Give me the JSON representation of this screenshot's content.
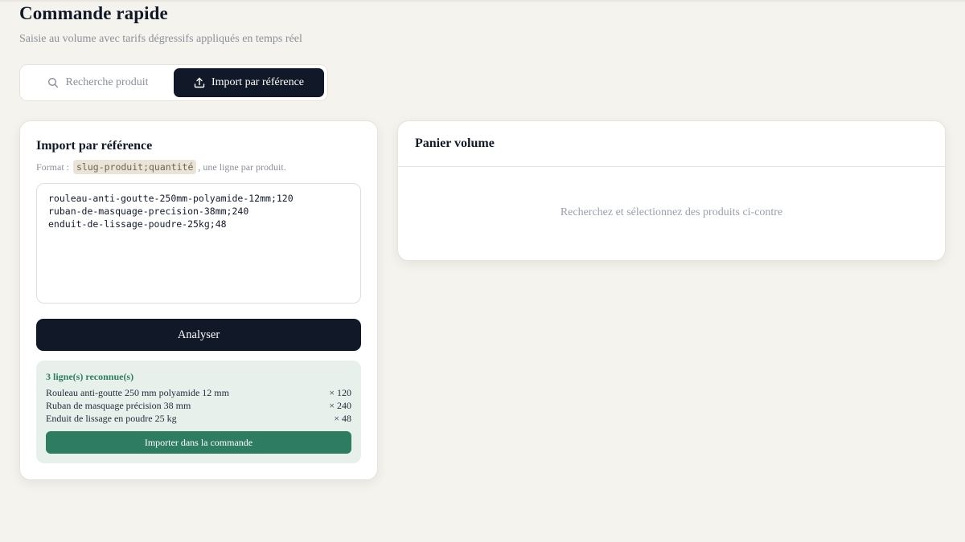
{
  "header": {
    "title": "Commande rapide",
    "subtitle": "Saisie au volume avec tarifs dégressifs appliqués en temps réel"
  },
  "mode_tabs": {
    "search": {
      "label": "Recherche produit",
      "icon": "search-icon",
      "active": false
    },
    "import": {
      "label": "Import par référence",
      "icon": "upload-icon",
      "active": true
    }
  },
  "import_panel": {
    "title": "Import par référence",
    "format_prefix": "Format :",
    "format_code": "slug-produit;quantité",
    "format_suffix": ", une ligne par produit.",
    "textarea_value": "rouleau-anti-goutte-250mm-polyamide-12mm;120\nruban-de-masquage-precision-38mm;240\nenduit-de-lissage-poudre-25kg;48",
    "analyze_label": "Analyser",
    "result": {
      "title": "3 ligne(s) reconnue(s)",
      "items": [
        {
          "name": "Rouleau anti-goutte 250 mm polyamide 12 mm",
          "qty": "× 120"
        },
        {
          "name": "Ruban de masquage précision 38 mm",
          "qty": "× 240"
        },
        {
          "name": "Enduit de lissage en poudre 25 kg",
          "qty": "× 48"
        }
      ],
      "import_label": "Importer dans la commande"
    }
  },
  "cart_panel": {
    "title": "Panier volume",
    "empty_text": "Recherchez et sélectionnez des produits ci-contre"
  },
  "colors": {
    "background": "#f5f3ee",
    "primary_dark": "#111827",
    "success_green": "#2e7d62",
    "success_bg": "#e8f0ec"
  }
}
